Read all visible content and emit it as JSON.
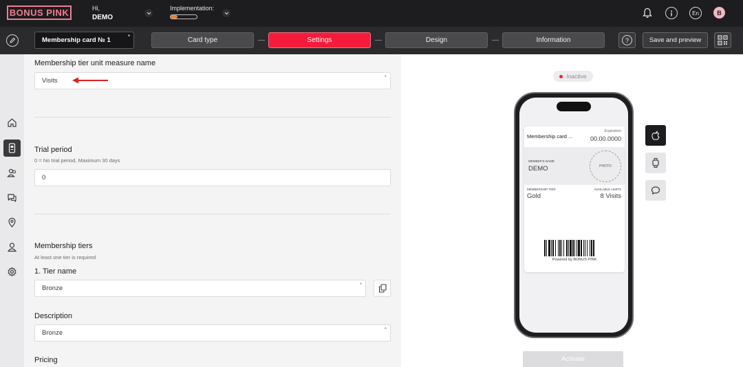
{
  "header": {
    "logo": "BONUS PINK",
    "greeting": "Hi,",
    "user": "DEMO",
    "implementation_label": "Implementation:",
    "implementation_progress": 0.25,
    "language": "En",
    "avatar_letter": "B"
  },
  "toolbar": {
    "card_name": "Membership card № 1",
    "required_mark": "*",
    "steps": [
      "Card type",
      "Settings",
      "Design",
      "Information"
    ],
    "active_step": "Settings",
    "help_label": "?",
    "save_label": "Save and preview"
  },
  "sidebar": {
    "items": [
      "home",
      "card",
      "clients",
      "messages",
      "locations",
      "users",
      "settings"
    ],
    "active_item": "card"
  },
  "form": {
    "unit_measure": {
      "label": "Membership tier unit measure name",
      "value": "Visits",
      "required": "*"
    },
    "trial": {
      "label": "Trial period",
      "hint": "0 = No trial period, Maximum 30 days",
      "value": "0"
    },
    "tiers": {
      "label": "Membership tiers",
      "hint": "At least one tier is required",
      "tier_label": "1. Tier name",
      "tier_value": "Bronze",
      "required": "*",
      "description_label": "Description",
      "description_value": "Bronze",
      "pricing_label": "Pricing"
    }
  },
  "preview": {
    "status": "Inactive",
    "status_color": "#f51b3a",
    "card": {
      "title": "Membership card ...",
      "expiration_label": "Expiration",
      "expiration_value": "00.00.0000",
      "member_name_label": "MEMBER'S NAME",
      "member_name_value": "DEMO",
      "photo_label": "PHOTO",
      "tier_label": "MEMBERSHIP TIER",
      "tier_value": "Gold",
      "limits_label": "AVAILABLE LIMITS",
      "limits_value": "8 Visits",
      "powered_by": "Powered by BONUS PINK"
    },
    "activate_label": "Activate"
  },
  "colors": {
    "accent": "#f51b3a",
    "brand_pink": "#f07f93",
    "header_bg": "#1d1d1f",
    "annotation_arrow": "#e02020"
  }
}
